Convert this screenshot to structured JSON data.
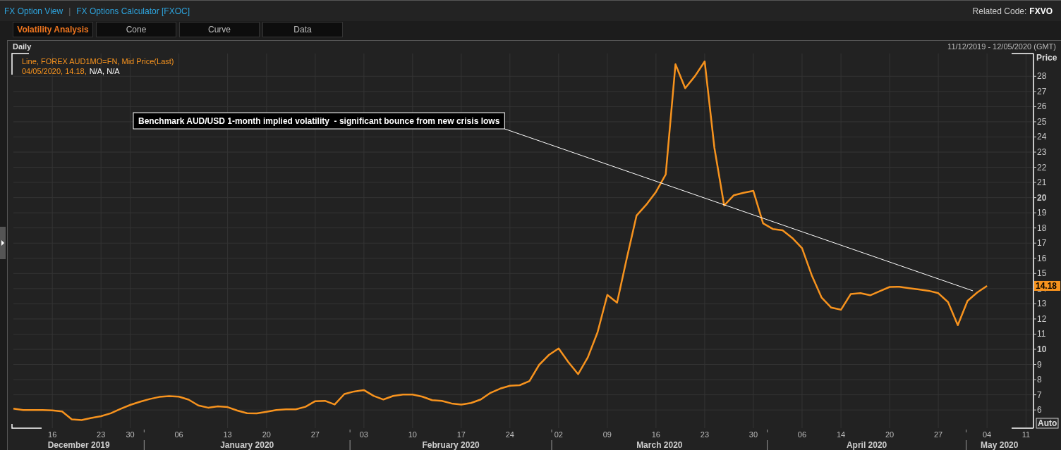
{
  "top_bar": {
    "links": [
      {
        "label": "FX Option View"
      },
      {
        "label": "FX Options Calculator [FXOC]"
      }
    ],
    "separator": "|",
    "related_code": {
      "label": "Related Code:",
      "value": "FXVO"
    }
  },
  "tabs": [
    {
      "label": "Volatility Analysis",
      "selected": true
    },
    {
      "label": "Cone",
      "selected": false
    },
    {
      "label": "Curve",
      "selected": false
    },
    {
      "label": "Data",
      "selected": false
    }
  ],
  "chart_panel": {
    "title": "Daily",
    "date_range": "11/12/2019 - 12/05/2020 (GMT)",
    "legend": {
      "series_line": "Line, FOREX AUD1MO=FN, Mid Price(Last)",
      "values_line": [
        {
          "text": "04/05/2020, 14.18,",
          "kind": "series"
        },
        {
          "text": "N/A, N/A",
          "kind": "plain"
        }
      ]
    },
    "price_marker": "14.18",
    "scale_button": "Auto",
    "x_months": [
      "December 2019",
      "January 2020",
      "February 2020",
      "March 2020",
      "April 2020",
      "May 2020"
    ],
    "chart_data": {
      "type": "line",
      "ylabel": "Price",
      "categories": [
        null,
        null,
        null,
        null,
        "16",
        null,
        null,
        null,
        null,
        "23",
        null,
        null,
        "30",
        null,
        null,
        null,
        null,
        "06",
        null,
        null,
        null,
        null,
        "13",
        null,
        null,
        null,
        "20",
        null,
        null,
        null,
        null,
        "27",
        null,
        null,
        null,
        null,
        "03",
        null,
        null,
        null,
        null,
        "10",
        null,
        null,
        null,
        null,
        "17",
        null,
        null,
        null,
        null,
        "24",
        null,
        null,
        null,
        null,
        "02",
        null,
        null,
        null,
        null,
        "09",
        null,
        null,
        null,
        null,
        "16",
        null,
        null,
        null,
        null,
        "23",
        null,
        null,
        null,
        null,
        "30",
        null,
        null,
        null,
        null,
        "06",
        null,
        null,
        null,
        "14",
        null,
        null,
        null,
        null,
        "20",
        null,
        null,
        null,
        null,
        "27",
        null,
        null,
        null,
        null,
        "04",
        null,
        null,
        null,
        "11"
      ],
      "series": [
        {
          "color": "#f7931e",
          "values": [
            6.09,
            6.0,
            6.0,
            6.0,
            5.97,
            5.9,
            5.38,
            5.34,
            5.47,
            5.59,
            5.78,
            6.07,
            6.33,
            6.54,
            6.72,
            6.86,
            6.91,
            6.88,
            6.68,
            6.3,
            6.15,
            6.24,
            6.19,
            5.96,
            5.79,
            5.78,
            5.88,
            6.0,
            6.04,
            6.04,
            6.21,
            6.58,
            6.6,
            6.36,
            7.05,
            7.22,
            7.31,
            6.93,
            6.69,
            6.92,
            7.02,
            7.02,
            6.88,
            6.65,
            6.6,
            6.43,
            6.35,
            6.46,
            6.69,
            7.13,
            7.41,
            7.6,
            7.63,
            7.9,
            8.98,
            9.63,
            10.06,
            9.15,
            8.36,
            9.47,
            11.13,
            13.59,
            13.08,
            16.0,
            18.81,
            19.53,
            20.38,
            21.53,
            28.79,
            27.21,
            28.01,
            28.98,
            23.28,
            19.48,
            20.16,
            20.32,
            20.44,
            18.3,
            17.93,
            17.85,
            17.34,
            16.67,
            14.88,
            13.42,
            12.75,
            12.61,
            13.64,
            13.7,
            13.56,
            13.84,
            14.11,
            14.12,
            14.03,
            13.94,
            13.86,
            13.7,
            13.11,
            11.59,
            13.19,
            13.75,
            14.18,
            null,
            null,
            null,
            null
          ]
        }
      ],
      "grid": true,
      "ylim": [
        4.8,
        29.5
      ],
      "yticks": [
        6,
        7,
        8,
        9,
        10,
        11,
        12,
        13,
        14,
        15,
        16,
        17,
        18,
        19,
        20,
        21,
        22,
        23,
        24,
        25,
        26,
        27,
        28
      ],
      "annotations": [
        "Benchmark AUD/USD 1-month implied volatility  - significant bounce from new crisis lows"
      ]
    }
  }
}
